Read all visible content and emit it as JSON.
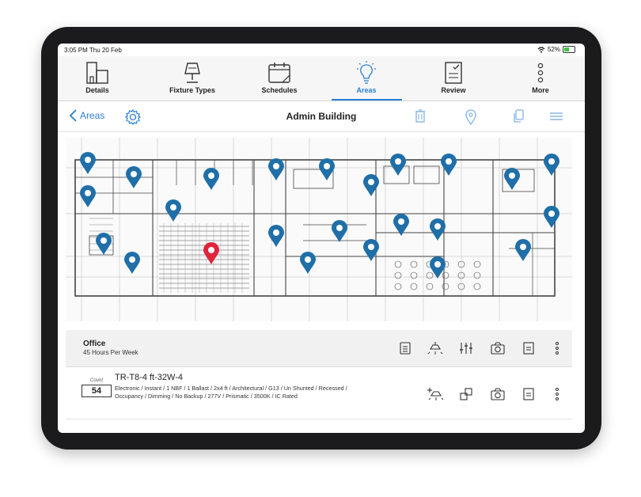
{
  "status": {
    "time": "3:05 PM  Thu 20 Feb",
    "battery": "52%",
    "battery_level": 0.52
  },
  "tabs": [
    {
      "label": "Details",
      "icon": "building-icon"
    },
    {
      "label": "Fixture Types",
      "icon": "lamp-icon"
    },
    {
      "label": "Schedules",
      "icon": "calendar-icon"
    },
    {
      "label": "Areas",
      "icon": "lightbulb-icon",
      "active": true
    },
    {
      "label": "Review",
      "icon": "clipboard-check-icon"
    },
    {
      "label": "More",
      "icon": "more-vertical-icon"
    }
  ],
  "nav": {
    "back_label": "Areas",
    "title": "Admin Building"
  },
  "colors": {
    "accent": "#2a7fd4",
    "pin": "#1f6fa8",
    "pin_selected": "#e0243c"
  },
  "area": {
    "name": "Office",
    "schedule": "45 Hours Per Week"
  },
  "fixture": {
    "count_label": "Count",
    "count": "54",
    "name": "TR-T8-4 ft-32W-4",
    "description": "Electronic / Instant / 1 NBF / 1 Ballast / 2x4 ft / Architectural / G13 / Un Shunted / Recessed / Occupancy / Dimming / No Backup / 277V / Prismatic / 3500K / IC Rated"
  }
}
